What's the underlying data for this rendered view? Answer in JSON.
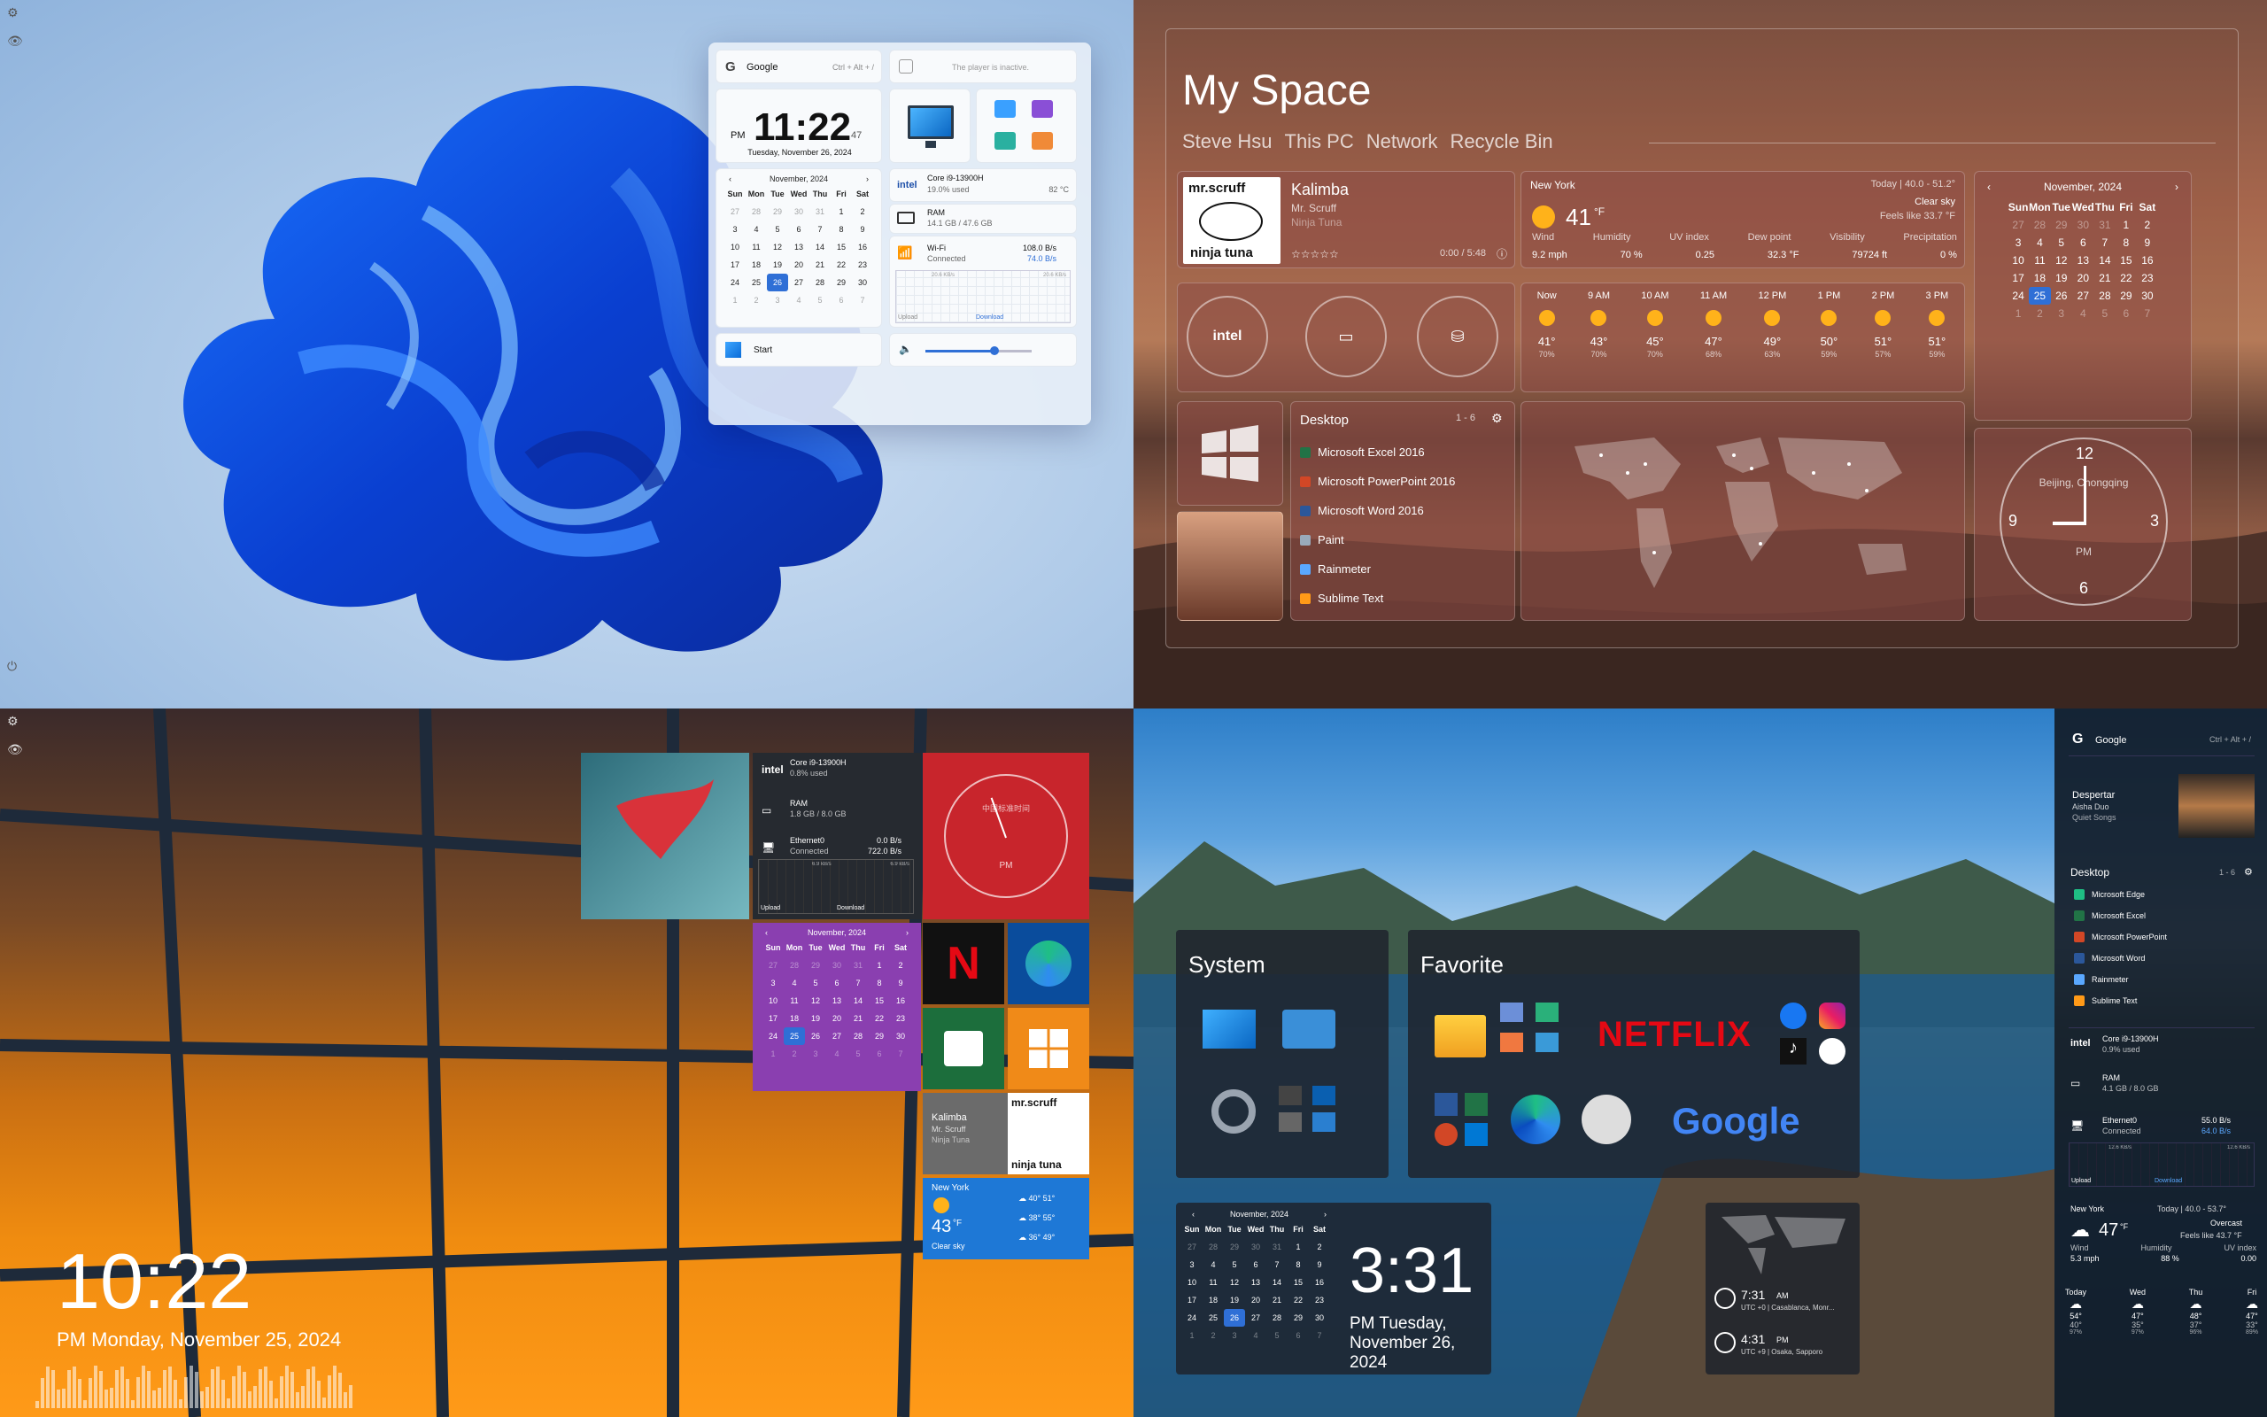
{
  "q1": {
    "google": {
      "label": "Google",
      "shortcut": "Ctrl + Alt + /"
    },
    "player": {
      "status": "The player is inactive."
    },
    "clock": {
      "ampm": "PM",
      "time": "11:22",
      "seconds": "47",
      "date": "Tuesday, November 26, 2024"
    },
    "calendar": {
      "title": "November, 2024",
      "days": [
        "Sun",
        "Mon",
        "Tue",
        "Wed",
        "Thu",
        "Fri",
        "Sat"
      ],
      "rows": [
        [
          "27",
          "28",
          "29",
          "30",
          "31",
          "1",
          "2"
        ],
        [
          "3",
          "4",
          "5",
          "6",
          "7",
          "8",
          "9"
        ],
        [
          "10",
          "11",
          "12",
          "13",
          "14",
          "15",
          "16"
        ],
        [
          "17",
          "18",
          "19",
          "20",
          "21",
          "22",
          "23"
        ],
        [
          "24",
          "25",
          "26",
          "27",
          "28",
          "29",
          "30"
        ],
        [
          "1",
          "2",
          "3",
          "4",
          "5",
          "6",
          "7"
        ]
      ],
      "today": "26"
    },
    "cpu": {
      "brand": "intel",
      "name": "Core i9-13900H",
      "usage": "19.0% used",
      "temp": "82 °C"
    },
    "ram": {
      "label": "RAM",
      "value": "14.1 GB / 47.6 GB"
    },
    "wifi": {
      "label": "Wi-Fi",
      "status": "Connected",
      "up": "108.0 B/s",
      "down": "74.0 B/s",
      "upload": "Upload",
      "download": "Download",
      "scale1": "20.6 KB/s",
      "scale2": "20.6 KB/s"
    },
    "start": {
      "label": "Start"
    },
    "volume": {
      "level": 0.65
    }
  },
  "q2": {
    "title": "My Space",
    "nav": [
      "Steve Hsu",
      "This PC",
      "Network",
      "Recycle Bin"
    ],
    "music": {
      "title": "Kalimba",
      "artist": "Mr. Scruff",
      "album": "Ninja Tuna",
      "time": "0:00 / 5:48",
      "art_top": "mr.scruff",
      "art_bottom": "ninja tuna"
    },
    "weather": {
      "city": "New York",
      "today": "Today | 40.0 - 51.2°",
      "temp": "41",
      "unit": "°F",
      "cond": "Clear sky",
      "feels": "Feels like 33.7 °F",
      "labels": [
        "Wind",
        "Humidity",
        "UV index",
        "Dew point",
        "Visibility",
        "Precipitation"
      ],
      "values": [
        "9.2 mph",
        "70 %",
        "0.25",
        "32.3 °F",
        "79724 ft",
        "0 %"
      ]
    },
    "hourly": [
      {
        "t": "Now",
        "v": "41°",
        "p": "70%"
      },
      {
        "t": "9 AM",
        "v": "43°",
        "p": "70%"
      },
      {
        "t": "10 AM",
        "v": "45°",
        "p": "70%"
      },
      {
        "t": "11 AM",
        "v": "47°",
        "p": "68%"
      },
      {
        "t": "12 PM",
        "v": "49°",
        "p": "63%"
      },
      {
        "t": "1 PM",
        "v": "50°",
        "p": "59%"
      },
      {
        "t": "2 PM",
        "v": "51°",
        "p": "57%"
      },
      {
        "t": "3 PM",
        "v": "51°",
        "p": "59%"
      }
    ],
    "calendar": {
      "title": "November, 2024",
      "days": [
        "Sun",
        "Mon",
        "Tue",
        "Wed",
        "Thu",
        "Fri",
        "Sat"
      ],
      "rows": [
        [
          "27",
          "28",
          "29",
          "30",
          "31",
          "1",
          "2"
        ],
        [
          "3",
          "4",
          "5",
          "6",
          "7",
          "8",
          "9"
        ],
        [
          "10",
          "11",
          "12",
          "13",
          "14",
          "15",
          "16"
        ],
        [
          "17",
          "18",
          "19",
          "20",
          "21",
          "22",
          "23"
        ],
        [
          "24",
          "25",
          "26",
          "27",
          "28",
          "29",
          "30"
        ],
        [
          "1",
          "2",
          "3",
          "4",
          "5",
          "6",
          "7"
        ]
      ],
      "today": "25"
    },
    "sys": {
      "intel": "intel"
    },
    "desktop": {
      "title": "Desktop",
      "range": "1 - 6",
      "items": [
        "Microsoft Excel 2016",
        "Microsoft PowerPoint 2016",
        "Microsoft Word 2016",
        "Paint",
        "Rainmeter",
        "Sublime Text"
      ]
    },
    "clock": {
      "city": "Beijing, Chongqing",
      "ampm": "PM",
      "n12": "12",
      "n3": "3",
      "n6": "6",
      "n9": "9"
    }
  },
  "q3": {
    "cpu": {
      "brand": "intel",
      "name": "Core i9-13900H",
      "usage": "0.8% used"
    },
    "ram": {
      "label": "RAM",
      "value": "1.8 GB / 8.0 GB"
    },
    "eth": {
      "label": "Ethernet0",
      "status": "Connected",
      "up": "0.0 B/s",
      "down": "722.0 B/s",
      "upload": "Upload",
      "download": "Download",
      "scale1": "6.9 kB/s",
      "scale2": "6.9 kB/s"
    },
    "clock": {
      "city": "中国标准时间",
      "ampm": "PM"
    },
    "calendar": {
      "title": "November, 2024",
      "days": [
        "Sun",
        "Mon",
        "Tue",
        "Wed",
        "Thu",
        "Fri",
        "Sat"
      ],
      "rows": [
        [
          "27",
          "28",
          "29",
          "30",
          "31",
          "1",
          "2"
        ],
        [
          "3",
          "4",
          "5",
          "6",
          "7",
          "8",
          "9"
        ],
        [
          "10",
          "11",
          "12",
          "13",
          "14",
          "15",
          "16"
        ],
        [
          "17",
          "18",
          "19",
          "20",
          "21",
          "22",
          "23"
        ],
        [
          "24",
          "25",
          "26",
          "27",
          "28",
          "29",
          "30"
        ],
        [
          "1",
          "2",
          "3",
          "4",
          "5",
          "6",
          "7"
        ]
      ],
      "today": "25"
    },
    "music": {
      "title": "Kalimba",
      "artist": "Mr. Scruff",
      "album": "Ninja Tuna",
      "art_top": "mr.scruff",
      "art_bottom": "ninja tuna"
    },
    "weather": {
      "city": "New York",
      "temp": "43",
      "unit": "°F",
      "cond": "Clear sky",
      "f1": "40°",
      "f1b": "51°",
      "f2": "38°",
      "f2b": "55°",
      "f3": "36°",
      "f3b": "49°"
    },
    "time": "10:22",
    "date": "PM Monday, November 25, 2024"
  },
  "q4": {
    "system": {
      "title": "System"
    },
    "favorite": {
      "title": "Favorite",
      "netflix": "NETFLIX",
      "google": "Google"
    },
    "calendar": {
      "title": "November, 2024",
      "days": [
        "Sun",
        "Mon",
        "Tue",
        "Wed",
        "Thu",
        "Fri",
        "Sat"
      ],
      "rows": [
        [
          "27",
          "28",
          "29",
          "30",
          "31",
          "1",
          "2"
        ],
        [
          "3",
          "4",
          "5",
          "6",
          "7",
          "8",
          "9"
        ],
        [
          "10",
          "11",
          "12",
          "13",
          "14",
          "15",
          "16"
        ],
        [
          "17",
          "18",
          "19",
          "20",
          "21",
          "22",
          "23"
        ],
        [
          "24",
          "25",
          "26",
          "27",
          "28",
          "29",
          "30"
        ],
        [
          "1",
          "2",
          "3",
          "4",
          "5",
          "6",
          "7"
        ]
      ],
      "today": "26"
    },
    "time": "3:31",
    "date": "PM Tuesday, November 26, 2024",
    "world": [
      {
        "time": "7:31",
        "ampm": "AM",
        "zone": "UTC +0 | Casablanca, Monr..."
      },
      {
        "time": "4:31",
        "ampm": "PM",
        "zone": "UTC +9 | Osaka, Sapporo"
      }
    ],
    "side": {
      "google": {
        "label": "Google",
        "shortcut": "Ctrl + Alt + /"
      },
      "music": {
        "title": "Despertar",
        "artist": "Aisha Duo",
        "album": "Quiet Songs"
      },
      "desktop": {
        "title": "Desktop",
        "range": "1 - 6",
        "items": [
          "Microsoft Edge",
          "Microsoft Excel",
          "Microsoft PowerPoint",
          "Microsoft Word",
          "Rainmeter",
          "Sublime Text"
        ]
      },
      "cpu": {
        "brand": "intel",
        "name": "Core i9-13900H",
        "usage": "0.9% used"
      },
      "ram": {
        "label": "RAM",
        "value": "4.1 GB / 8.0 GB"
      },
      "eth": {
        "label": "Ethernet0",
        "status": "Connected",
        "up": "55.0 B/s",
        "down": "64.0 B/s",
        "upload": "Upload",
        "download": "Download",
        "scale1": "12.6 KB/s",
        "scale2": "12.6 KB/s"
      },
      "weather": {
        "city": "New York",
        "today": "Today | 40.0 - 53.7°",
        "temp": "47",
        "unit": "°F",
        "cond": "Overcast",
        "feels": "Feels like 43.7 °F",
        "labels": [
          "Wind",
          "Humidity",
          "UV index"
        ],
        "values": [
          "5.3 mph",
          "88 %",
          "0.00"
        ]
      },
      "days": [
        {
          "d": "Today",
          "h": "54°",
          "l": "40°",
          "p": "97%"
        },
        {
          "d": "Wed",
          "h": "47°",
          "l": "35°",
          "p": "97%"
        },
        {
          "d": "Thu",
          "h": "48°",
          "l": "37°",
          "p": "96%"
        },
        {
          "d": "Fri",
          "h": "47°",
          "l": "33°",
          "p": "89%"
        }
      ]
    }
  }
}
